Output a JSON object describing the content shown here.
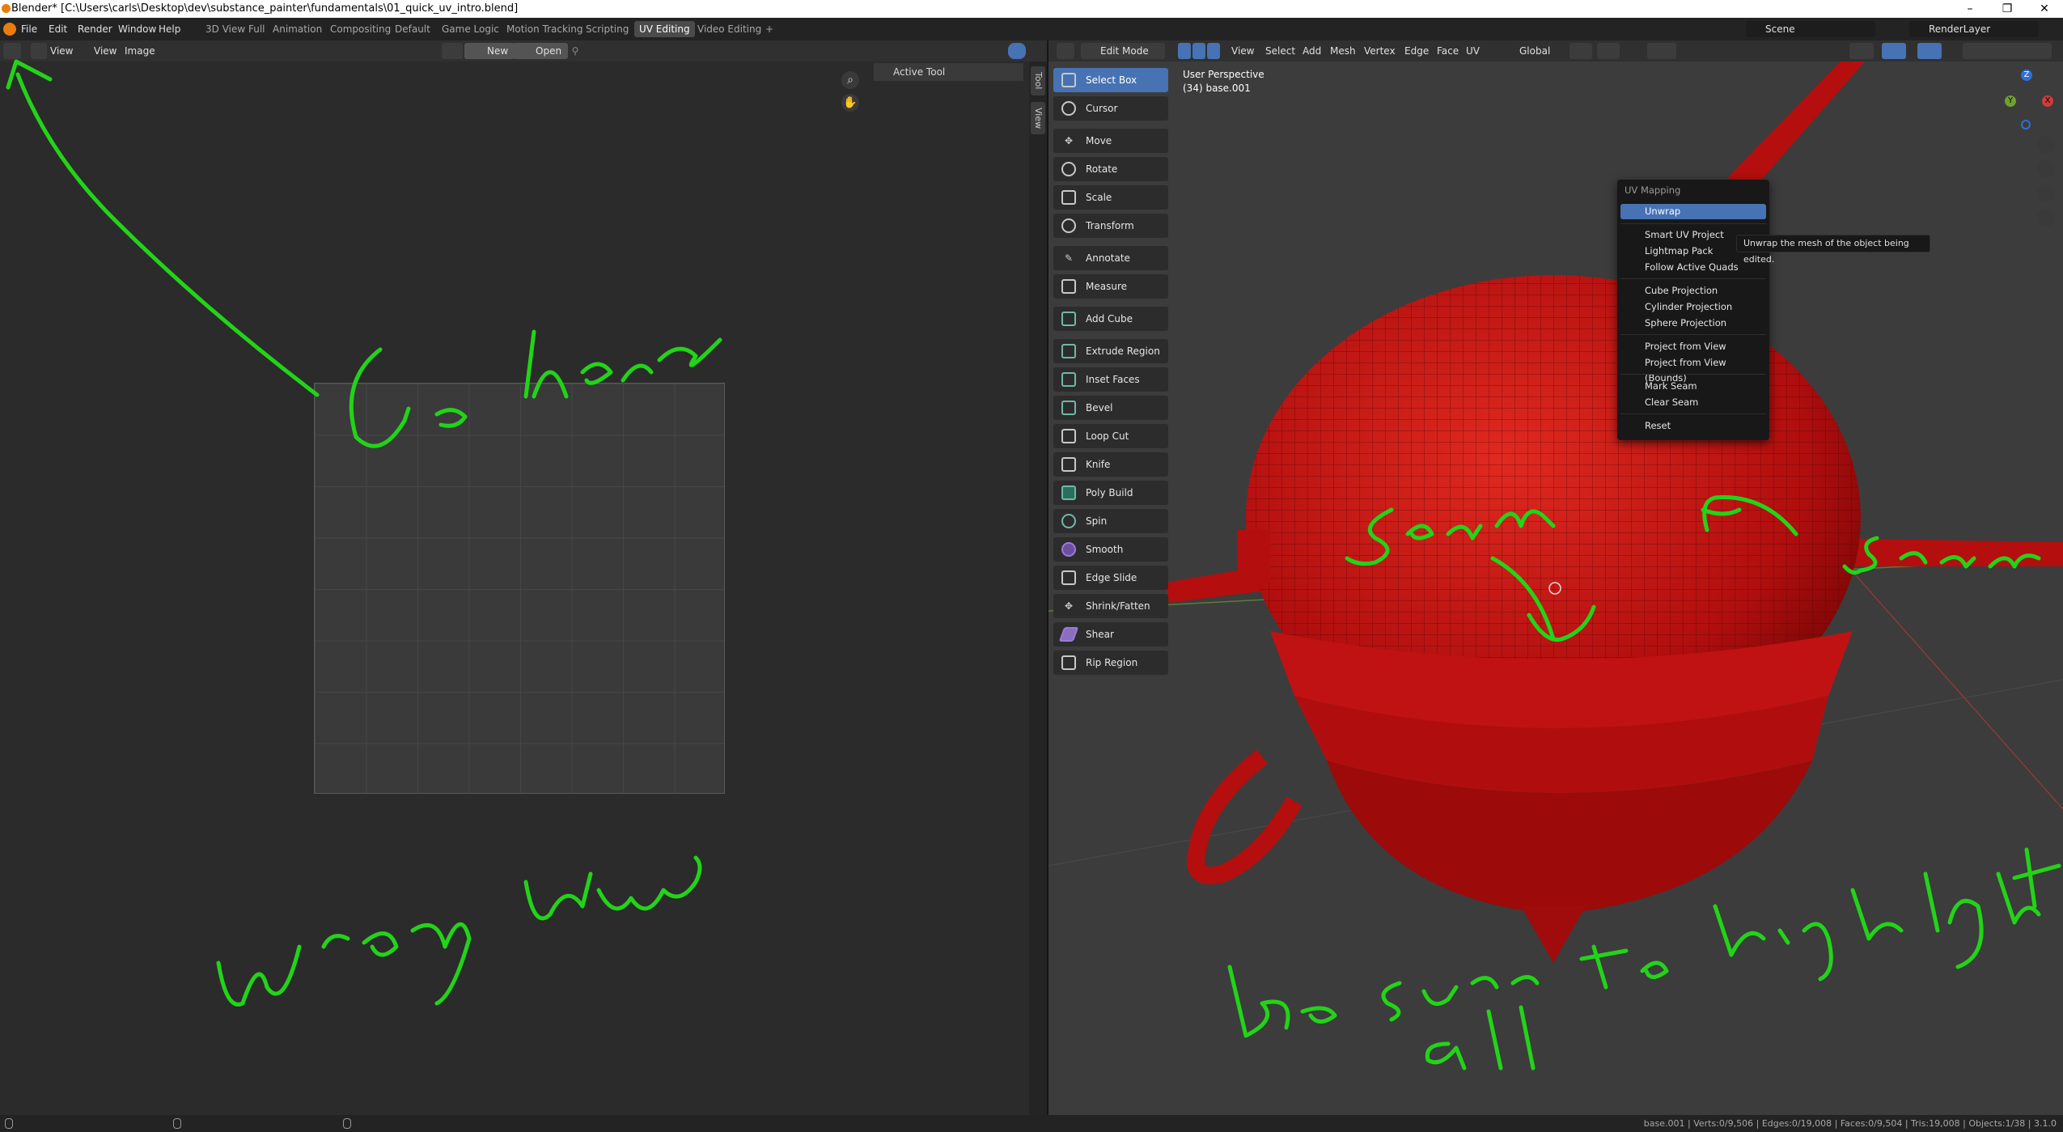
{
  "window": {
    "title": "Blender* [C:\\Users\\carls\\Desktop\\dev\\substance_painter\\fundamentals\\01_quick_uv_intro.blend]",
    "controls": [
      "–",
      "❐",
      "✕"
    ]
  },
  "topbar": {
    "menus": [
      "File",
      "Edit",
      "Render",
      "Window",
      "Help"
    ],
    "workspaces": [
      "3D View Full",
      "Animation",
      "Compositing",
      "Default",
      "Game Logic",
      "Motion Tracking",
      "Scripting",
      "UV Editing",
      "Video Editing"
    ],
    "active_workspace": "UV Editing",
    "add_workspace": "+",
    "scene": "Scene",
    "view_layer": "RenderLayer"
  },
  "left_editor": {
    "menus": [
      "View",
      "View",
      "Image"
    ],
    "new_label": "New",
    "open_label": "Open",
    "sidebar_panel": "Active Tool",
    "side_tabs": [
      "Tool",
      "View"
    ]
  },
  "right_editor": {
    "mode": "Edit Mode",
    "menus": [
      "View",
      "Select",
      "Add",
      "Mesh",
      "Vertex",
      "Edge",
      "Face",
      "UV"
    ],
    "orientation": "Global",
    "viewport_info": {
      "view": "User Perspective",
      "object": "(34) base.001"
    },
    "tools": [
      {
        "label": "Select Box",
        "active": true
      },
      {
        "label": "Cursor"
      },
      {
        "label": "Move"
      },
      {
        "label": "Rotate"
      },
      {
        "label": "Scale"
      },
      {
        "label": "Transform"
      },
      {
        "label": "Annotate"
      },
      {
        "label": "Measure"
      },
      {
        "label": "Add Cube"
      },
      {
        "label": "Extrude Region"
      },
      {
        "label": "Inset Faces"
      },
      {
        "label": "Bevel"
      },
      {
        "label": "Loop Cut"
      },
      {
        "label": "Knife"
      },
      {
        "label": "Poly Build"
      },
      {
        "label": "Spin"
      },
      {
        "label": "Smooth"
      },
      {
        "label": "Edge Slide"
      },
      {
        "label": "Shrink/Fatten"
      },
      {
        "label": "Shear"
      },
      {
        "label": "Rip Region"
      }
    ],
    "gizmo_axes": [
      "Z",
      "Y",
      "X"
    ]
  },
  "uv_menu": {
    "title": "UV Mapping",
    "items": [
      "Unwrap",
      "Smart UV Project",
      "Lightmap Pack",
      "Follow Active Quads",
      "Cube Projection",
      "Cylinder Projection",
      "Sphere Projection",
      "Project from View",
      "Project from View (Bounds)",
      "Mark Seam",
      "Clear Seam",
      "Reset"
    ],
    "selected": "Unwrap",
    "tooltip": "Unwrap the mesh of the object being edited."
  },
  "annotations": {
    "go_here": "Go here",
    "wrong_view": "Wrong View",
    "seam_left": "Seam",
    "seam_right": "Seam",
    "highlight": "Be sure to highlight all",
    "color": "#22d418"
  },
  "statusbar": {
    "stats": "base.001 | Verts:0/9,506 | Edges:0/19,008 | Faces:0/9,504 | Tris:19,008 | Objects:1/38 | 3.1.0"
  },
  "colors": {
    "accent": "#4772b3",
    "mesh": "#c41010",
    "background": "#303030"
  }
}
